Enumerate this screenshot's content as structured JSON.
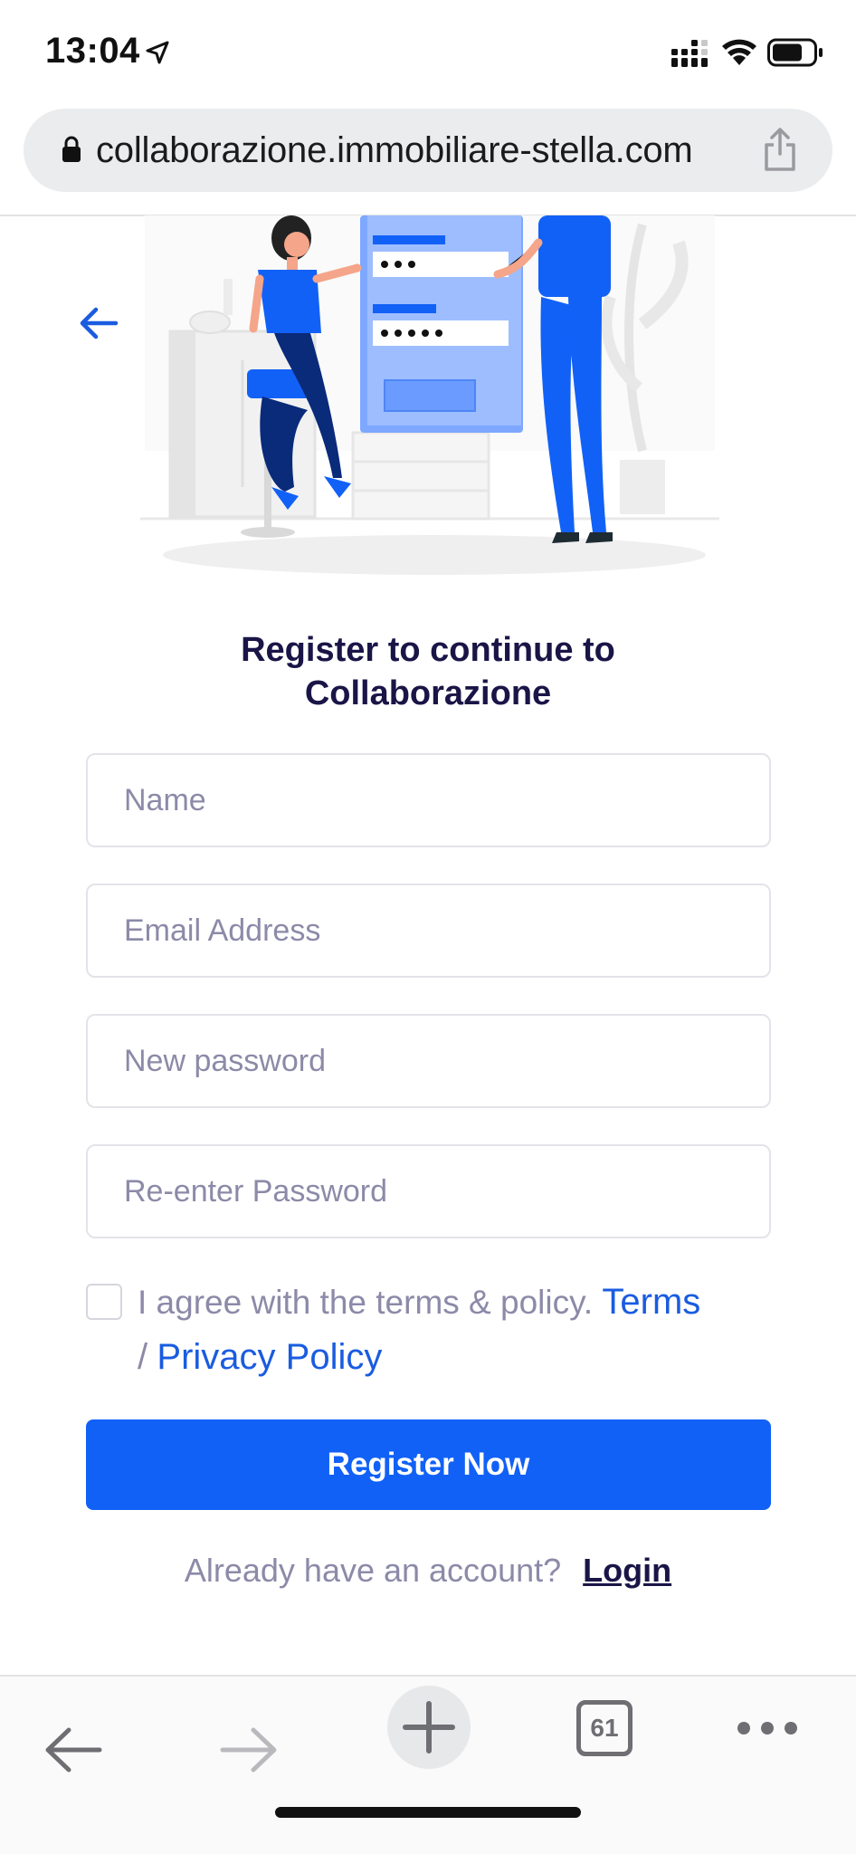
{
  "status_bar": {
    "time": "13:04"
  },
  "browser": {
    "url": "collaborazione.immobiliare-stella.com",
    "tabs_count": "61"
  },
  "form": {
    "heading_line1": "Register to continue to",
    "heading_line2": "Collaborazione",
    "name_placeholder": "Name",
    "email_placeholder": "Email Address",
    "password_placeholder": "New password",
    "repassword_placeholder": "Re-enter Password",
    "agree_text": "I agree with the terms & policy.",
    "terms_link": "Terms",
    "separator": "/",
    "privacy_link": "Privacy Policy",
    "register_button": "Register Now",
    "have_account_text": "Already have an account?",
    "login_link": "Login"
  },
  "colors": {
    "primary": "#1161f7",
    "heading": "#1a1547",
    "muted": "#8c8aa8",
    "link": "#1a5ce0"
  },
  "icons": {
    "back": "arrow-left-icon",
    "location": "location-arrow-icon",
    "signal": "cellular-signal-icon",
    "wifi": "wifi-icon",
    "battery": "battery-icon",
    "lock": "lock-icon",
    "share": "share-icon",
    "browser_back": "back-icon",
    "browser_forward": "forward-icon",
    "new_tab": "plus-icon",
    "more": "ellipsis-icon"
  }
}
